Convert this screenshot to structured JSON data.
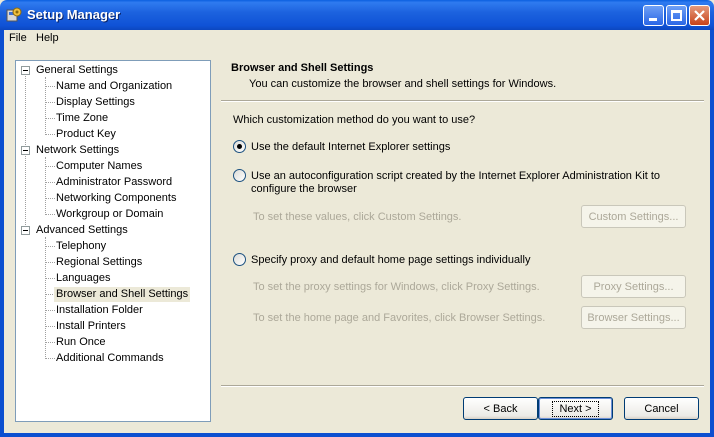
{
  "window": {
    "title": "Setup Manager",
    "icon": "setup-manager-app-icon",
    "controls": [
      "minimize",
      "maximize",
      "close"
    ]
  },
  "menu": {
    "file": "File",
    "help": "Help"
  },
  "tree": {
    "general": {
      "label": "General Settings",
      "items": [
        "Name and Organization",
        "Display Settings",
        "Time Zone",
        "Product Key"
      ]
    },
    "network": {
      "label": "Network Settings",
      "items": [
        "Computer Names",
        "Administrator Password",
        "Networking Components",
        "Workgroup or Domain"
      ]
    },
    "advanced": {
      "label": "Advanced Settings",
      "items": [
        "Telephony",
        "Regional Settings",
        "Languages",
        "Browser and Shell Settings",
        "Installation Folder",
        "Install Printers",
        "Run Once",
        "Additional Commands"
      ]
    },
    "selected": "Browser and Shell Settings"
  },
  "page": {
    "title": "Browser and Shell Settings",
    "description": "You can customize the browser and shell settings for Windows.",
    "question": "Which customization method do you want to use?",
    "option1": {
      "label": "Use the default Internet Explorer settings",
      "checked": true
    },
    "option2": {
      "line1": "Use an autoconfiguration script created by the Internet Explorer Administration Kit to",
      "line2": "configure the browser",
      "checked": false,
      "hint": "To set these values, click Custom Settings.",
      "button": "Custom Settings..."
    },
    "option3": {
      "label": "Specify proxy and default home page settings individually",
      "checked": false,
      "hint_proxy": "To set the proxy settings for Windows, click Proxy Settings.",
      "button_proxy": "Proxy Settings...",
      "hint_browser": "To set the home page and Favorites, click Browser Settings.",
      "button_browser": "Browser Settings..."
    }
  },
  "footer": {
    "back": "< Back",
    "next": "Next >",
    "cancel": "Cancel"
  }
}
